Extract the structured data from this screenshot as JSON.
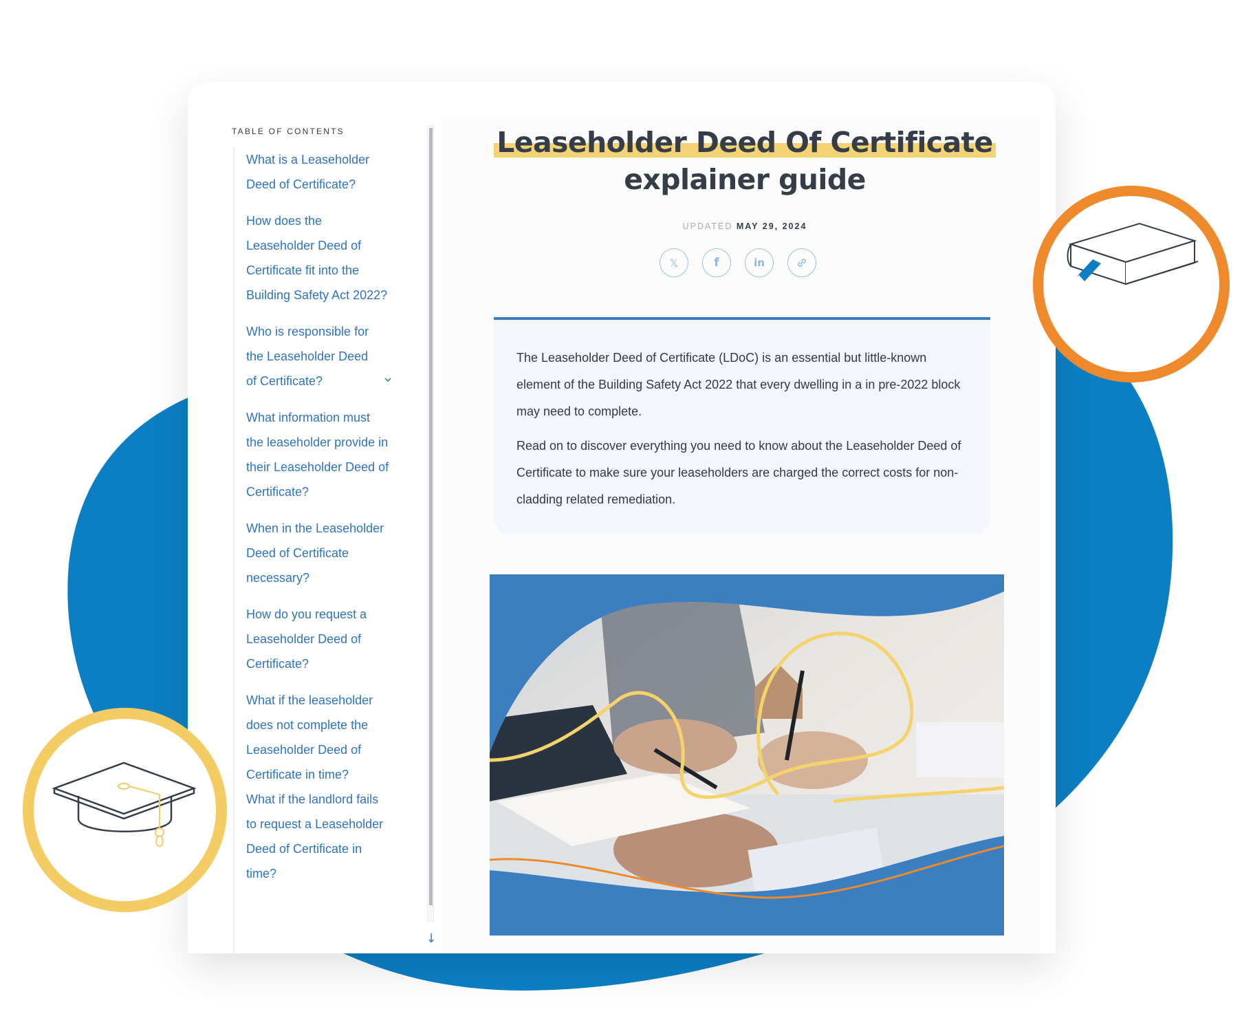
{
  "toc": {
    "heading": "TABLE OF CONTENTS",
    "scroll_up_icon": "↑",
    "scroll_down_icon": "↓",
    "items": [
      {
        "label": "What is a Leaseholder Deed of Certificate?"
      },
      {
        "label": "How does the Leaseholder Deed of Certificate fit into the Building Safety Act 2022?"
      },
      {
        "label": "Who is responsible for the Leaseholder Deed of Certificate?",
        "expandable": true
      },
      {
        "label": "What information must the leaseholder provide in their Leaseholder Deed of Certificate?"
      },
      {
        "label": "When in the Leaseholder Deed of Certificate necessary?"
      },
      {
        "label": "How do you request a Leaseholder Deed of Certificate?"
      },
      {
        "label": "What if the leaseholder does not complete the Leaseholder Deed of Certificate in time?"
      },
      {
        "label": "What if the landlord fails to request a Leaseholder Deed of Certificate in time?"
      }
    ]
  },
  "article": {
    "title_highlight": "Leaseholder Deed Of Certificate",
    "title_rest": "explainer guide",
    "updated_label": "UPDATED",
    "updated_date": "MAY 29, 2024",
    "share": [
      {
        "name": "x-twitter",
        "glyph": "𝕏"
      },
      {
        "name": "facebook",
        "glyph": "f"
      },
      {
        "name": "linkedin",
        "glyph": "in"
      },
      {
        "name": "copy-link",
        "glyph": "🔗"
      }
    ],
    "summary": [
      "The Leaseholder Deed of Certificate (LDoC) is an essential but little-known element of the Building Safety Act 2022 that every dwelling in a in pre-2022 block may need to complete.",
      "Read on to discover everything you need to know about the Leaseholder Deed of Certificate to make sure your leaseholders are charged the correct costs for non-cladding related remediation."
    ]
  },
  "decor": {
    "book_icon": "book-icon",
    "cap_icon": "graduation-cap-icon",
    "colors": {
      "brand_blue": "#0c7fc4",
      "link_blue": "#2f74c0",
      "orange": "#ef8a2c",
      "yellow": "#f3cd64",
      "highlight": "#f3d373",
      "text_dark": "#343d48"
    }
  }
}
